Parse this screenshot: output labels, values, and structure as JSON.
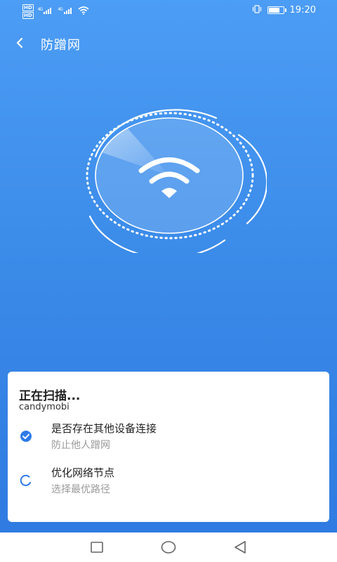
{
  "status_bar": {
    "hd_top": "HD",
    "hd_bottom": "HD",
    "net1": "4G",
    "net2": "4G",
    "time": "19:20",
    "battery_level": 0.8
  },
  "header": {
    "title": "防蹭网",
    "back_icon": "chevron-left-icon"
  },
  "scan_graphic": {
    "icon": "wifi-icon"
  },
  "card": {
    "title": "正在扫描...",
    "network_name": "candymobi",
    "tasks": [
      {
        "title": "是否存在其他设备连接",
        "desc": "防止他人蹭网",
        "status": "done",
        "icon": "check-circle-icon"
      },
      {
        "title": "优化网络节点",
        "desc": "选择最优路径",
        "status": "loading",
        "icon": "spinner-icon"
      }
    ]
  },
  "colors": {
    "accent": "#2e7be8",
    "background_top": "#4c9df5",
    "background_bottom": "#2e79e0"
  },
  "navbar": {
    "icons": [
      "recent-apps-icon",
      "home-icon",
      "back-triangle-icon"
    ]
  }
}
